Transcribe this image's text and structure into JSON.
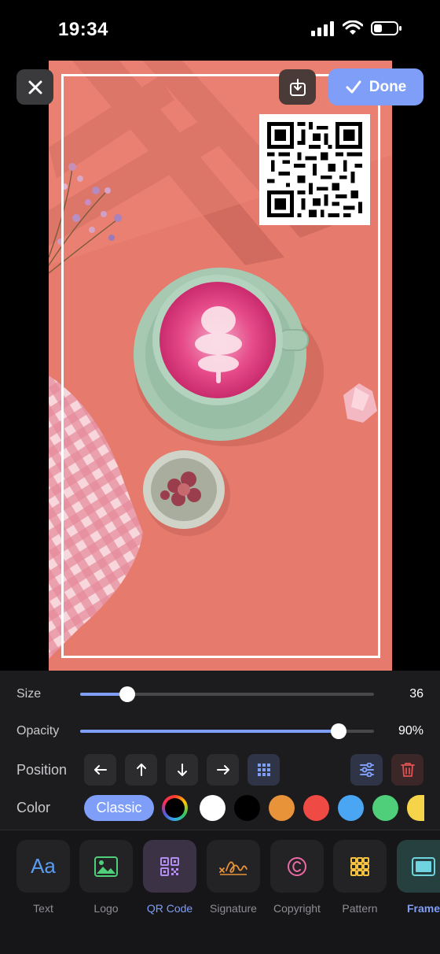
{
  "status_bar": {
    "time": "19:34"
  },
  "header": {
    "done_label": "Done"
  },
  "controls": {
    "size": {
      "label": "Size",
      "value": "36",
      "fraction": 0.16
    },
    "opacity": {
      "label": "Opacity",
      "value": "90%",
      "fraction": 0.88
    },
    "position": {
      "label": "Position"
    },
    "color": {
      "label": "Color",
      "classic_label": "Classic",
      "swatches": [
        "rainbow",
        "#ffffff",
        "#000000",
        "#e8923a",
        "#f04a45",
        "#4aa6f2",
        "#4fcf7a",
        "#f5d449"
      ]
    }
  },
  "toolbar": {
    "items": [
      {
        "label": "Text",
        "icon": "text-icon"
      },
      {
        "label": "Logo",
        "icon": "image-icon"
      },
      {
        "label": "QR Code",
        "icon": "qr-code-icon"
      },
      {
        "label": "Signature",
        "icon": "signature-icon"
      },
      {
        "label": "Copyright",
        "icon": "copyright-icon"
      },
      {
        "label": "Pattern",
        "icon": "grid-icon"
      },
      {
        "label": "Frame",
        "icon": "frame-icon"
      }
    ],
    "active": "QR Code"
  },
  "colors": {
    "accent": "#7f9ef7",
    "canvas": "#e67a6c",
    "panel": "#1c1c1e",
    "delete": "#e05252"
  }
}
